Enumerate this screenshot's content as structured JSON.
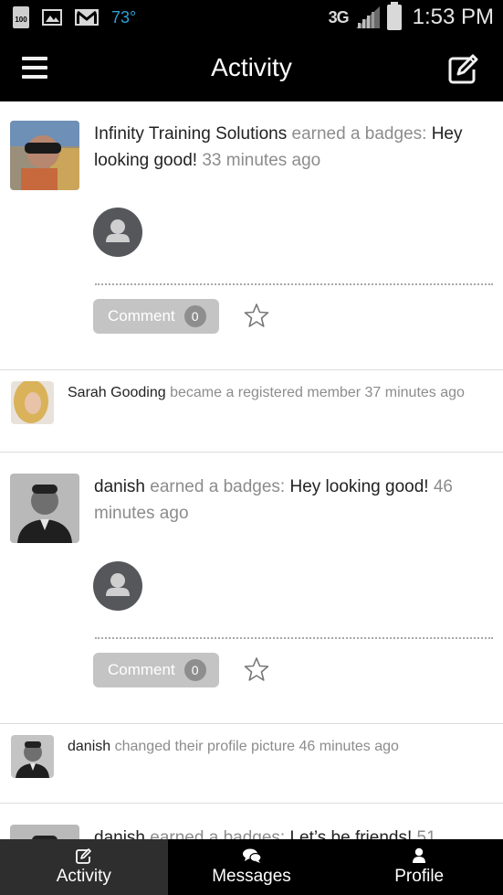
{
  "status_bar": {
    "battery_small": "100",
    "temperature": "73°",
    "network": "3G",
    "time": "1:53 PM"
  },
  "header": {
    "title": "Activity",
    "menu_icon": "hamburger-icon",
    "compose_icon": "compose-icon"
  },
  "feed": [
    {
      "type": "badge",
      "actor": "Infinity Training Solutions",
      "action": "earned a badges:",
      "badge_name": "Hey looking good!",
      "time": "33 minutes ago",
      "comment_label": "Comment",
      "comment_count": "0"
    },
    {
      "type": "member",
      "actor": "Sarah Gooding",
      "action": "became a registered member",
      "time": "37 minutes ago"
    },
    {
      "type": "badge",
      "actor": "danish",
      "action": "earned a badges:",
      "badge_name": "Hey looking good!",
      "time": "46 minutes ago",
      "comment_label": "Comment",
      "comment_count": "0"
    },
    {
      "type": "profile",
      "actor": "danish",
      "action": "changed their profile picture",
      "time": "46 minutes ago"
    },
    {
      "type": "badge",
      "actor": "danish",
      "action": "earned a badges:",
      "badge_name": "Let’s be friends!",
      "time": "51"
    }
  ],
  "nav": {
    "tabs": [
      {
        "label": "Activity",
        "icon": "compose-icon",
        "active": true
      },
      {
        "label": "Messages",
        "icon": "chat-bubbles-icon",
        "active": false
      },
      {
        "label": "Profile",
        "icon": "person-icon",
        "active": false
      }
    ]
  }
}
